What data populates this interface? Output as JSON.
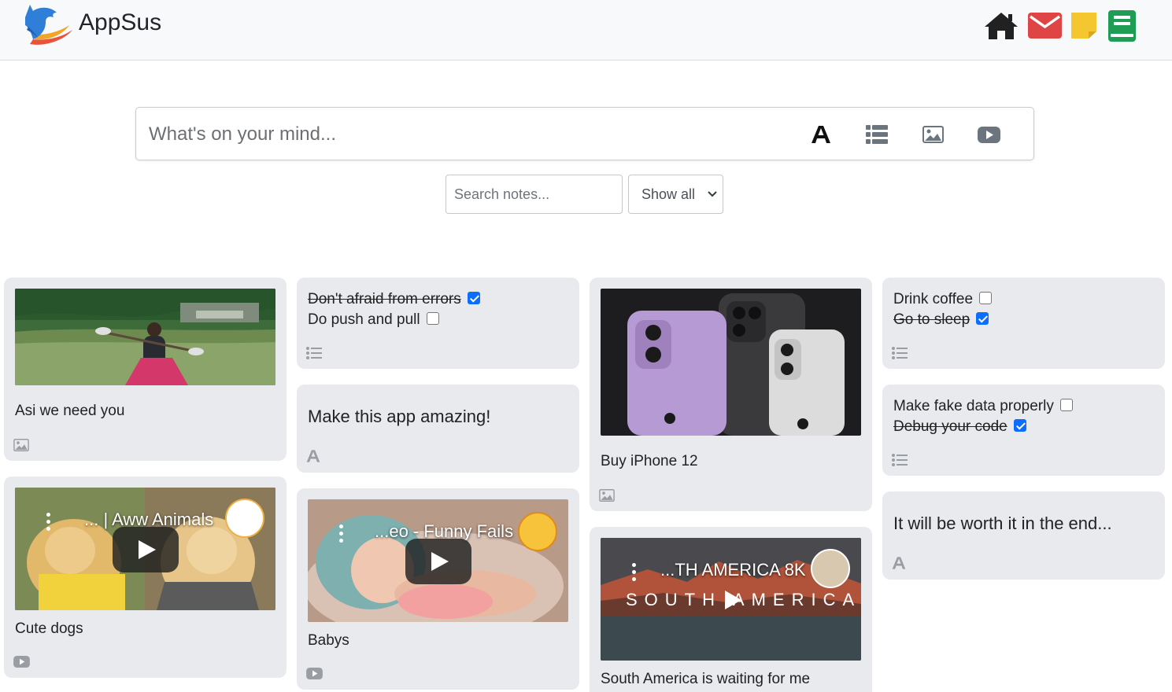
{
  "header": {
    "app_name": "AppSus",
    "colors": {
      "home": "#212121",
      "mail": "#e04545",
      "keep": "#f4c730",
      "books": "#1f9d55"
    }
  },
  "composer": {
    "placeholder": "What's on your mind...",
    "tools": [
      "text-icon",
      "list-icon",
      "image-icon",
      "video-icon"
    ]
  },
  "filter": {
    "search_placeholder": "Search notes...",
    "select_value": "Show all"
  },
  "notes": {
    "c1": {
      "label": "Asi we need you"
    },
    "c2": {
      "label": "Cute dogs",
      "video_title": "... | Aww Animals"
    },
    "c3": {
      "todos": [
        {
          "text": "Don't afraid from errors",
          "done": true
        },
        {
          "text": "Do push and pull",
          "done": false
        }
      ]
    },
    "c4": {
      "text": "Make this app amazing!"
    },
    "c5": {
      "label": "Babys",
      "video_title": "...eo - Funny Fails"
    },
    "c6": {
      "label": "Buy iPhone 12"
    },
    "c7": {
      "label": "South America is waiting for me",
      "video_title": "...TH AMERICA 8K",
      "video_overlay": "SOUTH AMERICA"
    },
    "c8": {
      "todos": [
        {
          "text": "Drink coffee",
          "done": false
        },
        {
          "text": "Go to sleep",
          "done": true
        }
      ]
    },
    "c9": {
      "todos": [
        {
          "text": "Make fake data properly",
          "done": false
        },
        {
          "text": "Debug your code",
          "done": true
        }
      ]
    },
    "c10": {
      "text": "It will be worth it in the end..."
    }
  }
}
